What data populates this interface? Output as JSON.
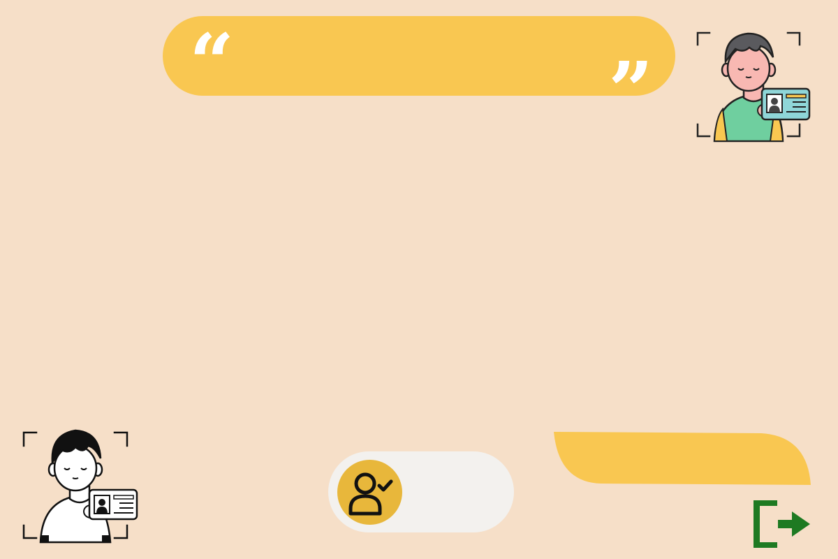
{
  "header": {
    "quote_open": "“",
    "quote_close": "”",
    "quote_text": ""
  },
  "icons": {
    "avatar_top": "person-id-card-color-icon",
    "avatar_bottom": "person-id-card-outline-icon",
    "user_verified": "user-check-icon",
    "exit": "exit-arrow-icon"
  },
  "colors": {
    "background": "#f6dfc8",
    "accent_yellow": "#f9c751",
    "pill_grey": "#f3f1ee",
    "user_circle": "#e8b73b",
    "exit_green": "#1e7a22",
    "shirt_green": "#6fcf9f",
    "card_blue": "#8fd6d8"
  }
}
